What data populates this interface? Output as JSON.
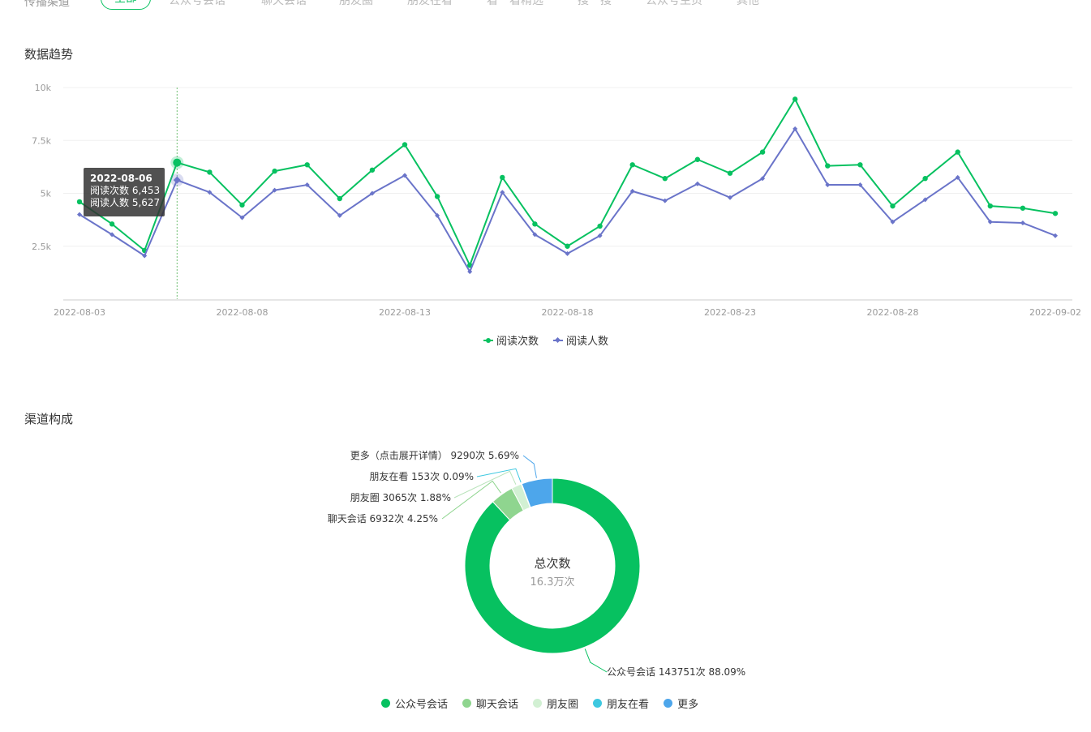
{
  "channel_tabs": {
    "label": "传播渠道",
    "items": [
      "全部",
      "公众号会话",
      "聊天会话",
      "朋友圈",
      "朋友在看",
      "看一看精选",
      "搜一搜",
      "公众号主页",
      "其他"
    ]
  },
  "trend_section": {
    "title": "数据趋势"
  },
  "composition_section": {
    "title": "渠道构成"
  },
  "colors": {
    "green": "#07c160",
    "purple": "#6a74c9",
    "accent": "#07c160"
  },
  "chart_data": [
    {
      "type": "line",
      "title": "数据趋势",
      "x": [
        "2022-08-03",
        "2022-08-04",
        "2022-08-05",
        "2022-08-06",
        "2022-08-07",
        "2022-08-08",
        "2022-08-09",
        "2022-08-10",
        "2022-08-11",
        "2022-08-12",
        "2022-08-13",
        "2022-08-14",
        "2022-08-15",
        "2022-08-16",
        "2022-08-17",
        "2022-08-18",
        "2022-08-19",
        "2022-08-20",
        "2022-08-21",
        "2022-08-22",
        "2022-08-23",
        "2022-08-24",
        "2022-08-25",
        "2022-08-26",
        "2022-08-27",
        "2022-08-28",
        "2022-08-29",
        "2022-08-30",
        "2022-08-31",
        "2022-09-01",
        "2022-09-02"
      ],
      "x_tick_labels": [
        "2022-08-03",
        "2022-08-08",
        "2022-08-13",
        "2022-08-18",
        "2022-08-23",
        "2022-08-28",
        "2022-09-02"
      ],
      "y_tick_labels": [
        "10k",
        "7.5k",
        "5k",
        "2.5k"
      ],
      "y_ticks": [
        10000,
        7500,
        5000,
        2500
      ],
      "ylim": [
        0,
        10000
      ],
      "series": [
        {
          "name": "阅读次数",
          "color": "#07c160",
          "marker": "circle",
          "values": [
            4600,
            3550,
            2300,
            6453,
            6000,
            4450,
            6050,
            6350,
            4750,
            6100,
            7300,
            4850,
            1600,
            5750,
            3550,
            2500,
            3450,
            6350,
            5700,
            6600,
            5950,
            6950,
            9450,
            6300,
            6350,
            4400,
            5700,
            6950,
            4400,
            4300,
            4050
          ]
        },
        {
          "name": "阅读人数",
          "color": "#6a74c9",
          "marker": "diamond",
          "values": [
            4000,
            3050,
            2050,
            5627,
            5050,
            3850,
            5150,
            5400,
            3950,
            5000,
            5850,
            3950,
            1300,
            5050,
            3050,
            2150,
            3000,
            5100,
            4650,
            5450,
            4800,
            5700,
            8050,
            5400,
            5400,
            3650,
            4700,
            5750,
            3650,
            3600,
            3000
          ]
        }
      ],
      "grid": true,
      "legend": "bottom-center",
      "tooltip": {
        "date": "2022-08-06",
        "rows": [
          "阅读次数 6,453",
          "阅读人数 5,627"
        ]
      }
    },
    {
      "type": "pie",
      "title": "渠道构成",
      "center_title": "总次数",
      "center_value": "16.3万次",
      "legend": "bottom-center",
      "slices": [
        {
          "name": "公众号会话",
          "count": 143751,
          "percent": 88.09,
          "color": "#07c160",
          "label": "公众号会话 143751次 88.09%"
        },
        {
          "name": "聊天会话",
          "count": 6932,
          "percent": 4.25,
          "color": "#8fd58f",
          "label": "聊天会话 6932次 4.25%"
        },
        {
          "name": "朋友圈",
          "count": 3065,
          "percent": 1.88,
          "color": "#d2f0d3",
          "label": "朋友圈 3065次 1.88%"
        },
        {
          "name": "朋友在看",
          "count": 153,
          "percent": 0.09,
          "color": "#3ec8e0",
          "label": "朋友在看 153次 0.09%"
        },
        {
          "name": "更多",
          "count": 9290,
          "percent": 5.69,
          "color": "#4da6eb",
          "label": "更多（点击展开详情） 9290次 5.69%"
        }
      ]
    }
  ]
}
